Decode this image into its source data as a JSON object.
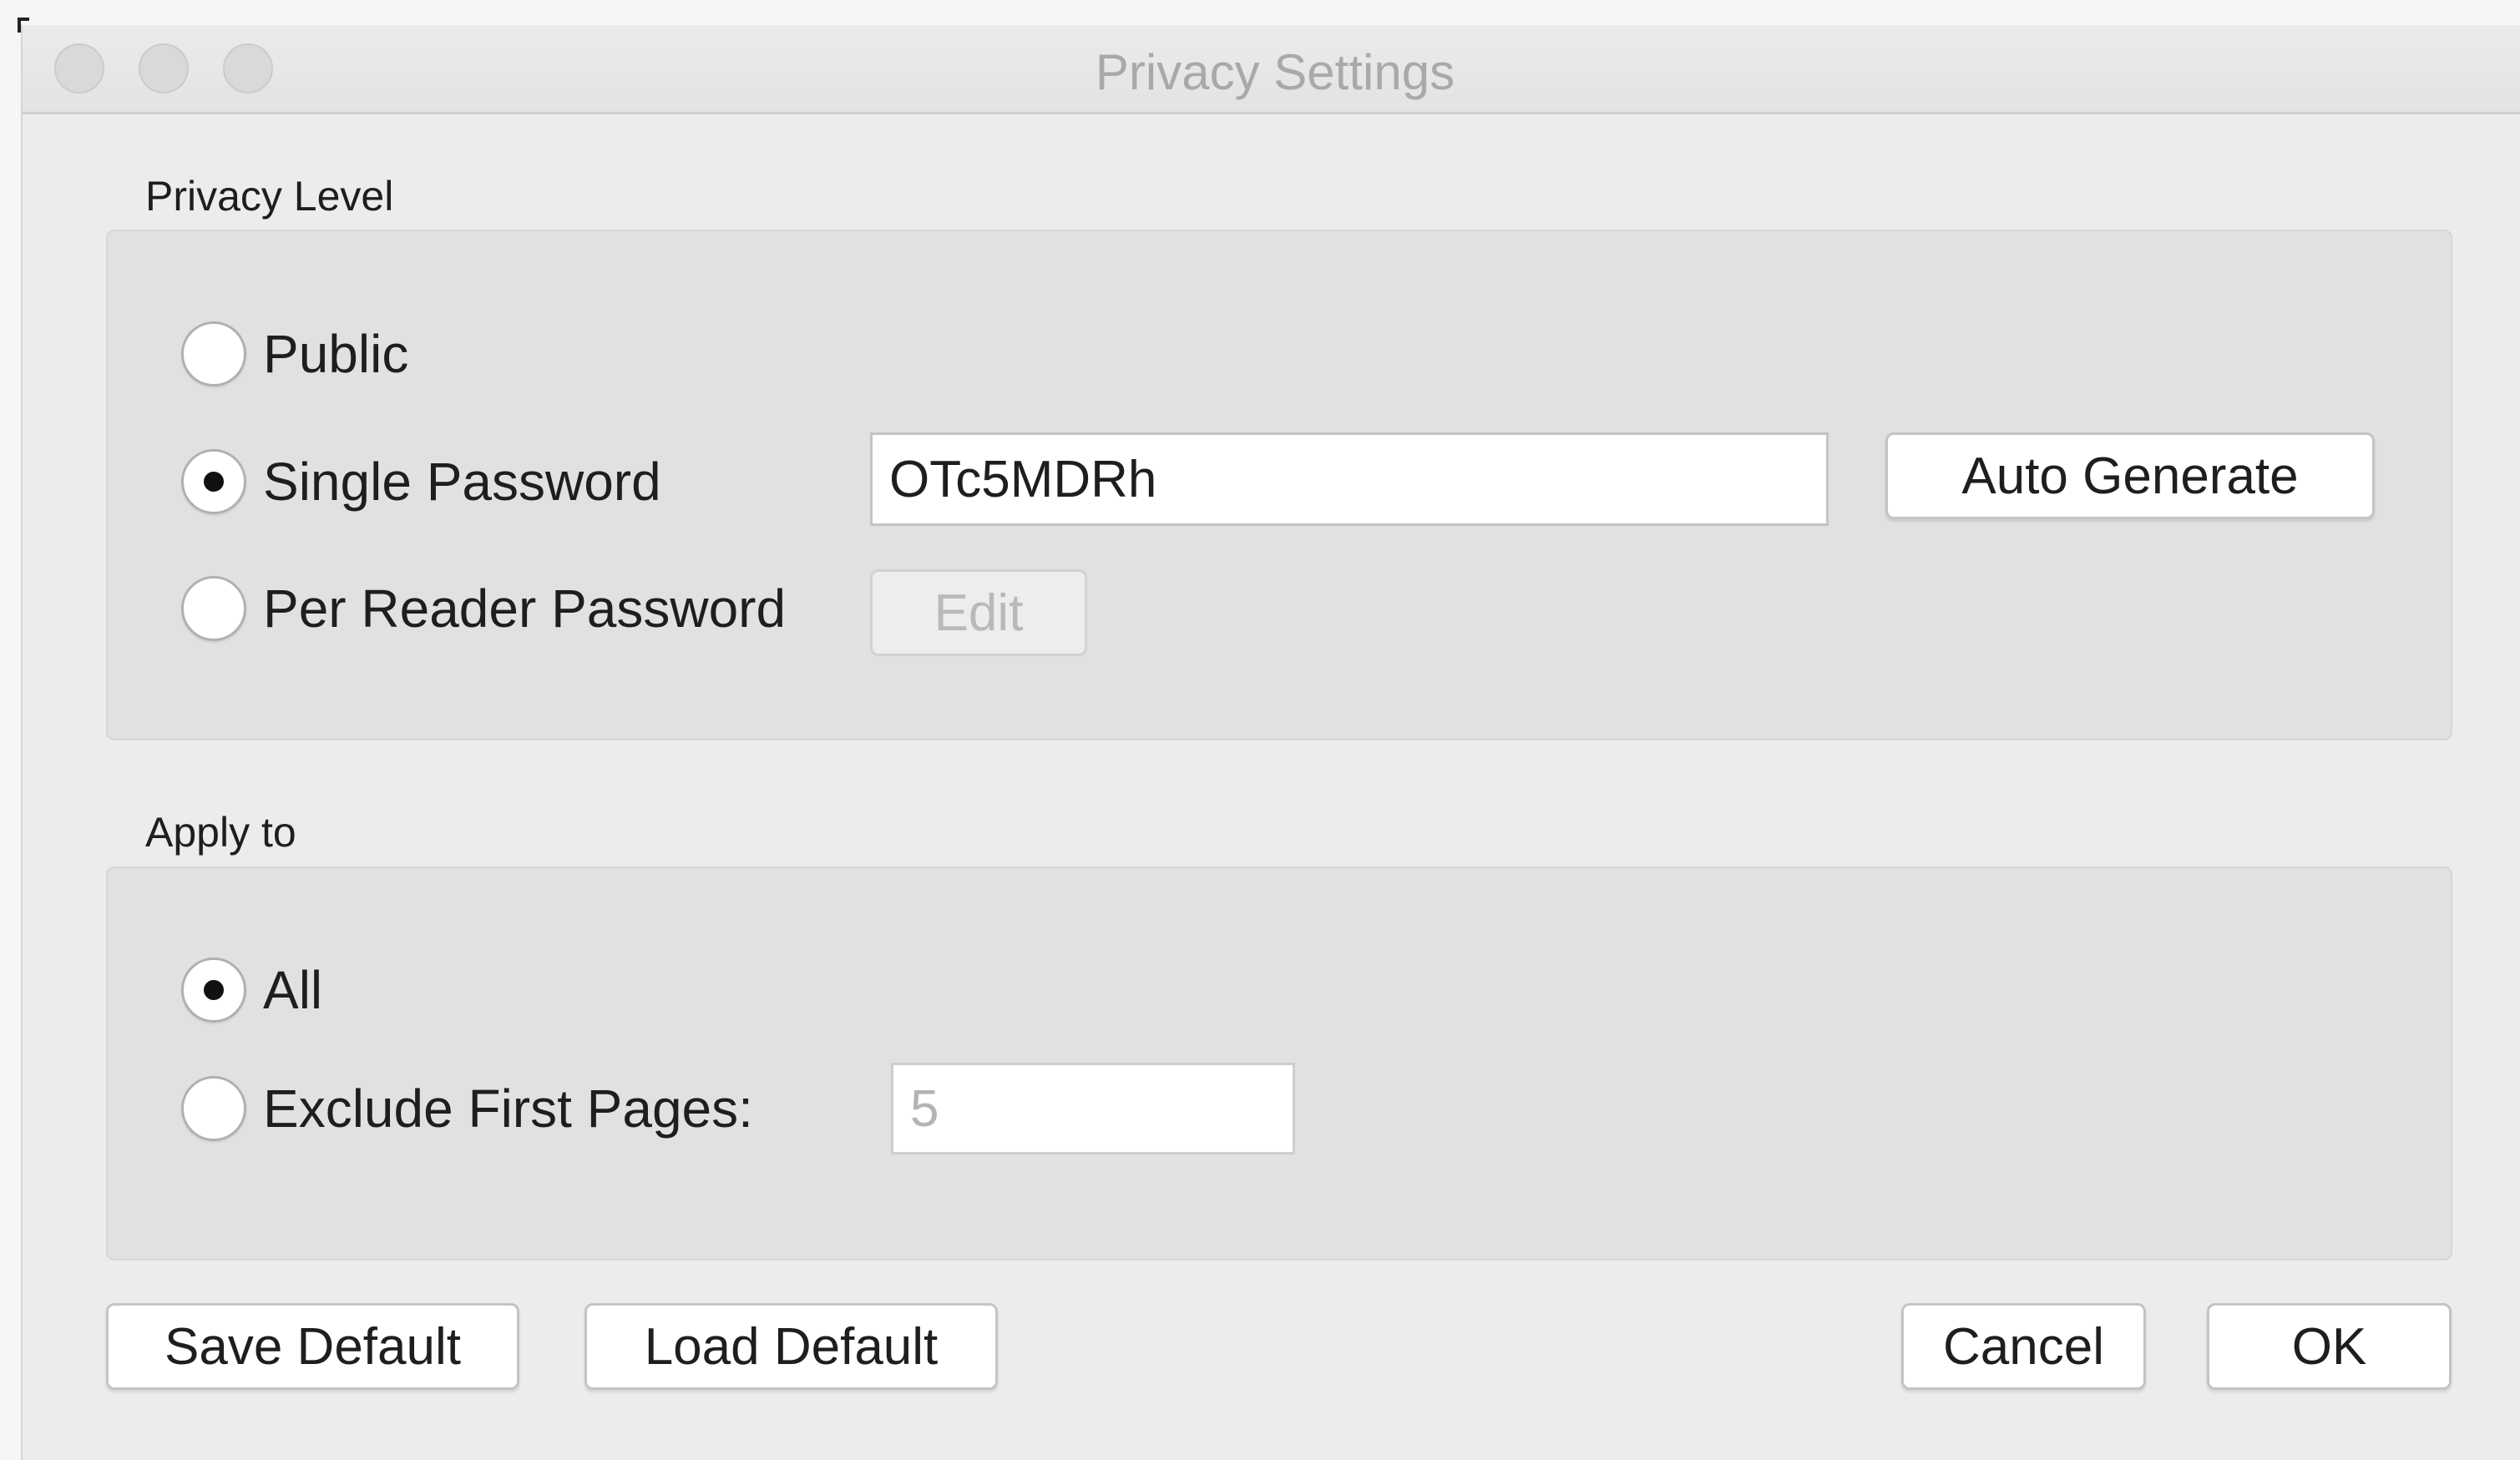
{
  "window": {
    "title": "Privacy Settings"
  },
  "privacy_level": {
    "label": "Privacy Level",
    "options": [
      {
        "label": "Public",
        "checked": false
      },
      {
        "label": "Single Password",
        "checked": true
      },
      {
        "label": "Per Reader Password",
        "checked": false
      }
    ],
    "password_value": "OTc5MDRh",
    "auto_generate_label": "Auto Generate",
    "edit_label": "Edit"
  },
  "apply_to": {
    "label": "Apply to",
    "options": [
      {
        "label": "All",
        "checked": true
      },
      {
        "label": "Exclude First Pages:",
        "checked": false
      }
    ],
    "pages_value": "5"
  },
  "footer": {
    "save_default_label": "Save Default",
    "load_default_label": "Load Default",
    "cancel_label": "Cancel",
    "ok_label": "OK"
  }
}
